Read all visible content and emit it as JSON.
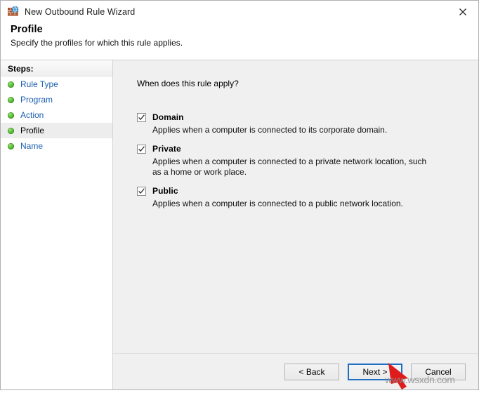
{
  "window": {
    "title": "New Outbound Rule Wizard",
    "icon": "firewall-wall-globe-icon",
    "close_label": "✕"
  },
  "header": {
    "title": "Profile",
    "subtitle": "Specify the profiles for which this rule applies."
  },
  "sidebar": {
    "heading": "Steps:",
    "items": [
      {
        "label": "Rule Type",
        "state": "completed"
      },
      {
        "label": "Program",
        "state": "completed"
      },
      {
        "label": "Action",
        "state": "completed"
      },
      {
        "label": "Profile",
        "state": "current"
      },
      {
        "label": "Name",
        "state": "completed"
      }
    ]
  },
  "main": {
    "question": "When does this rule apply?",
    "options": [
      {
        "label": "Domain",
        "checked": true,
        "description": "Applies when a computer is connected to its corporate domain."
      },
      {
        "label": "Private",
        "checked": true,
        "description": "Applies when a computer is connected to a private network location, such as a home or work place."
      },
      {
        "label": "Public",
        "checked": true,
        "description": "Applies when a computer is connected to a public network location."
      }
    ]
  },
  "footer": {
    "back_label": "< Back",
    "next_label": "Next >",
    "cancel_label": "Cancel",
    "focused_button": "Next >"
  },
  "overlay": {
    "watermark": "www.wsxdn.com",
    "pointer_color": "#e01b1b"
  },
  "colors": {
    "link": "#1b5fb0",
    "content_background": "#f0f0f0",
    "focus_border": "#1f6fc4",
    "step_bullet": "#4fb02a"
  }
}
